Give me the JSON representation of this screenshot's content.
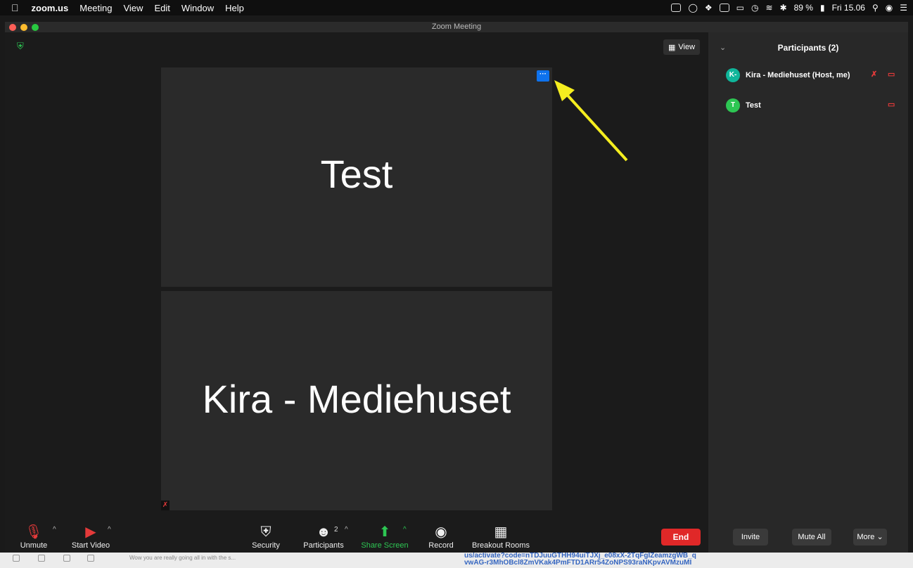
{
  "menubar": {
    "app": "zoom.us",
    "items": [
      "Meeting",
      "View",
      "Edit",
      "Window",
      "Help"
    ],
    "battery": "89 %",
    "clock": "Fri 15.06"
  },
  "window": {
    "title": "Zoom Meeting"
  },
  "view_button": "View",
  "tiles": [
    {
      "name": "Test"
    },
    {
      "name": "Kira - Mediehuset"
    }
  ],
  "tile_more_glyph": "···",
  "toolbar": {
    "unmute": "Unmute",
    "start_video": "Start Video",
    "security": "Security",
    "participants": "Participants",
    "participants_count": "2",
    "share_screen": "Share Screen",
    "record": "Record",
    "breakout_rooms": "Breakout Rooms",
    "end": "End"
  },
  "panel": {
    "title": "Participants (2)",
    "participants": [
      {
        "initials": "K-",
        "name": "Kira - Mediehuset (Host, me)",
        "avatar_color": "#0fb59a"
      },
      {
        "initials": "T",
        "name": "Test",
        "avatar_color": "#2dc653"
      }
    ],
    "invite": "Invite",
    "mute_all": "Mute All",
    "more": "More"
  },
  "background": {
    "email_preview": "Wow you are really going all in with the s...",
    "url_line1": "us/activate?code=nTDJuuGTHH94uiTJXj_e08xX-2TqFgIZeamzgWB_q",
    "url_line2": "vwAG-r3MhOBcl8ZmVKak4PmFTD1ARr54ZoNPS93raNKpvAVMzuMI"
  },
  "colors": {
    "accent_blue": "#0e72ed",
    "share_green": "#2dc653",
    "end_red": "#e02828",
    "annotation_arrow": "#f5ee1f"
  }
}
